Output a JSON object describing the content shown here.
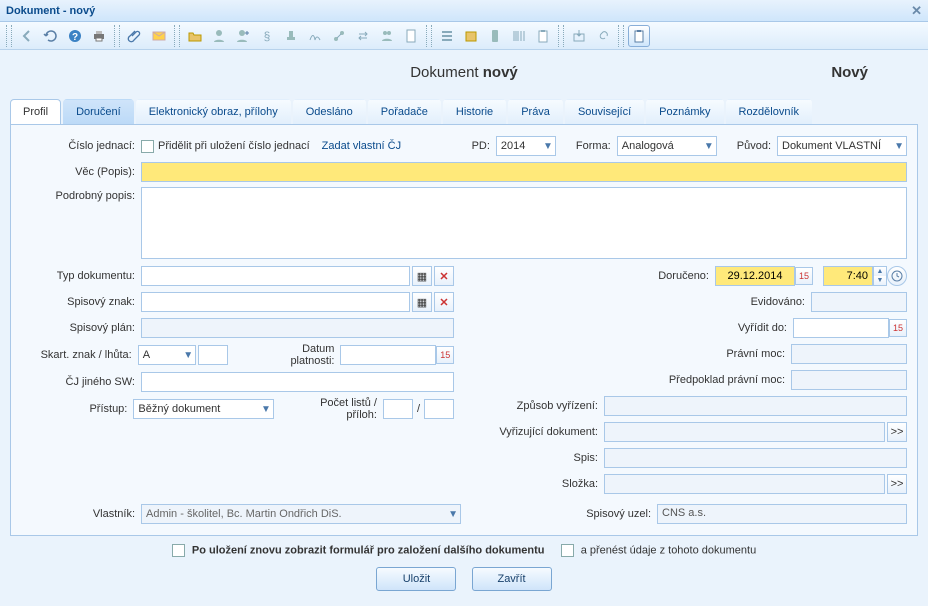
{
  "window": {
    "title": "Dokument - nový"
  },
  "heading": {
    "prefix": "Dokument ",
    "suffix": "nový",
    "status": "Nový"
  },
  "tabs": [
    "Profil",
    "Doručení",
    "Elektronický obraz, přílohy",
    "Odesláno",
    "Pořadače",
    "Historie",
    "Práva",
    "Související",
    "Poznámky",
    "Rozdělovník"
  ],
  "labels": {
    "cislo_jednaci": "Číslo jednací:",
    "pridelit": "Přidělit při uložení číslo jednací",
    "zadat_cj": "Zadat vlastní ČJ",
    "pd": "PD:",
    "forma": "Forma:",
    "puvod": "Původ:",
    "vec": "Věc (Popis):",
    "podrobny": "Podrobný popis:",
    "typ_dok": "Typ dokumentu:",
    "spis_znak": "Spisový znak:",
    "spis_plan": "Spisový plán:",
    "skart": "Skart. znak / lhůta:",
    "datum_plat": "Datum platnosti:",
    "cj_sw": "ČJ jiného SW:",
    "pristup": "Přístup:",
    "pocet_listu": "Počet listů / příloh:",
    "vlastnik": "Vlastník:",
    "doruceno": "Doručeno:",
    "evidovano": "Evidováno:",
    "vyridit": "Vyřídit do:",
    "pravni_moc": "Právní moc:",
    "predpoklad": "Předpoklad právní moc:",
    "zpusob": "Způsob vyřízení:",
    "vyriz_dok": "Vyřizující dokument:",
    "spis": "Spis:",
    "slozka": "Složka:",
    "spis_uzel": "Spisový uzel:",
    "footer1": "Po uložení znovu zobrazit formulář pro založení dalšího dokumentu",
    "footer2": "a přenést údaje z tohoto dokumentu",
    "ulozit": "Uložit",
    "zavrit": "Zavřít",
    "slash": "/",
    "cal": "15",
    "more": ">>"
  },
  "values": {
    "pd": "2014",
    "forma": "Analogová",
    "puvod": "Dokument VLASTNÍ",
    "vec": "",
    "podrobny": "",
    "typ_dok": "",
    "spis_znak": "",
    "spis_plan": "",
    "skart_znak": "A",
    "skart_lhuta": "",
    "datum_plat": "",
    "cj_sw": "",
    "pristup": "Běžný dokument",
    "pocet_listu": "",
    "pocet_priloh": "",
    "vlastnik": "Admin - školitel, Bc. Martin Ondřich DiS.",
    "doruceno_date": "29.12.2014",
    "doruceno_time": "7:40",
    "evidovano": "",
    "vyridit": "",
    "pravni_moc": "",
    "predpoklad": "",
    "zpusob": "",
    "vyriz_dok": "",
    "spis": "",
    "slozka": "",
    "spis_uzel": "CNS a.s."
  }
}
